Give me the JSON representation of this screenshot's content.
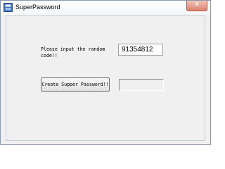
{
  "window": {
    "title": "SuperPassword",
    "app_icon": "app-logo-icon",
    "close_icon": "close-icon",
    "close_glyph": "✕"
  },
  "form": {
    "prompt_label": "Please input the random code!!",
    "code_value": "91354812",
    "create_button_label": "Create Supper Password!!",
    "output_value": ""
  }
}
